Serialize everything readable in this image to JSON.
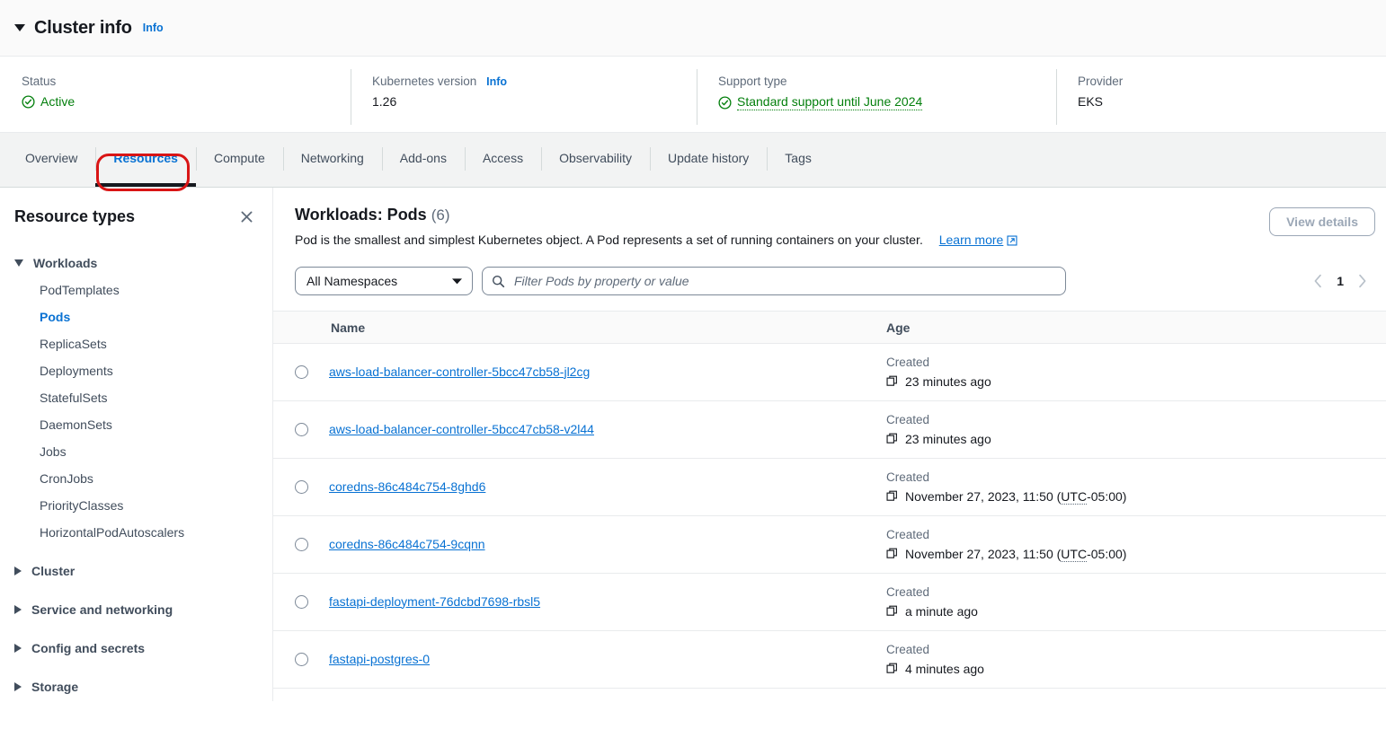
{
  "cluster_info": {
    "title": "Cluster info",
    "info_link": "Info",
    "collapse_icon": "caret-down-icon",
    "fields": [
      {
        "label": "Status",
        "value": "Active",
        "icon": "green-check-circle-icon",
        "style": "green"
      },
      {
        "label": "Kubernetes version",
        "info_link": "Info",
        "value": "1.26",
        "style": "plain"
      },
      {
        "label": "Support type",
        "value": "Standard support until June 2024",
        "icon": "green-check-circle-icon",
        "style": "green-dotted"
      },
      {
        "label": "Provider",
        "value": "EKS",
        "style": "plain"
      }
    ]
  },
  "tabs": [
    {
      "label": "Overview",
      "active": false
    },
    {
      "label": "Resources",
      "active": true
    },
    {
      "label": "Compute",
      "active": false
    },
    {
      "label": "Networking",
      "active": false
    },
    {
      "label": "Add-ons",
      "active": false
    },
    {
      "label": "Access",
      "active": false
    },
    {
      "label": "Observability",
      "active": false
    },
    {
      "label": "Update history",
      "active": false
    },
    {
      "label": "Tags",
      "active": false
    }
  ],
  "annotation": {
    "shape": "rounded-rectangle",
    "color": "#d91515",
    "target": "Resources"
  },
  "sidebar": {
    "title": "Resource types",
    "close_icon": "close-icon",
    "groups": [
      {
        "label": "Workloads",
        "expanded": true,
        "items": [
          {
            "label": "PodTemplates",
            "selected": false
          },
          {
            "label": "Pods",
            "selected": true
          },
          {
            "label": "ReplicaSets",
            "selected": false
          },
          {
            "label": "Deployments",
            "selected": false
          },
          {
            "label": "StatefulSets",
            "selected": false
          },
          {
            "label": "DaemonSets",
            "selected": false
          },
          {
            "label": "Jobs",
            "selected": false
          },
          {
            "label": "CronJobs",
            "selected": false
          },
          {
            "label": "PriorityClasses",
            "selected": false
          },
          {
            "label": "HorizontalPodAutoscalers",
            "selected": false
          }
        ]
      },
      {
        "label": "Cluster",
        "expanded": false,
        "items": []
      },
      {
        "label": "Service and networking",
        "expanded": false,
        "items": []
      },
      {
        "label": "Config and secrets",
        "expanded": false,
        "items": []
      },
      {
        "label": "Storage",
        "expanded": false,
        "items": []
      }
    ]
  },
  "main": {
    "heading": "Workloads: Pods",
    "count": "(6)",
    "description": "Pod is the smallest and simplest Kubernetes object. A Pod represents a set of running containers on your cluster.",
    "learn_more": "Learn more",
    "learn_more_icon": "external-link-icon",
    "view_details_label": "View details",
    "view_details_disabled": true,
    "namespace_filter": {
      "value": "All Namespaces",
      "icon": "chevron-down-icon"
    },
    "search": {
      "placeholder": "Filter Pods by property or value",
      "value": "",
      "icon": "search-icon"
    },
    "pagination": {
      "page": "1",
      "prev_icon": "chevron-left-icon",
      "next_icon": "chevron-right-icon",
      "prev_disabled": true,
      "next_disabled": true
    },
    "table": {
      "columns": [
        "Name",
        "Age"
      ],
      "rows": [
        {
          "name": "aws-load-balancer-controller-5bcc47cb58-jl2cg",
          "age_label": "Created",
          "age_value": "23 minutes ago",
          "copy_icon": "copy-icon",
          "selected": false
        },
        {
          "name": "aws-load-balancer-controller-5bcc47cb58-v2l44",
          "age_label": "Created",
          "age_value": "23 minutes ago",
          "copy_icon": "copy-icon",
          "selected": false
        },
        {
          "name": "coredns-86c484c754-8ghd6",
          "age_label": "Created",
          "age_value_pre": "November 27, 2023, 11:50 (",
          "age_abbr": "UTC",
          "age_value_post": "-05:00)",
          "copy_icon": "copy-icon",
          "selected": false
        },
        {
          "name": "coredns-86c484c754-9cqnn",
          "age_label": "Created",
          "age_value_pre": "November 27, 2023, 11:50 (",
          "age_abbr": "UTC",
          "age_value_post": "-05:00)",
          "copy_icon": "copy-icon",
          "selected": false
        },
        {
          "name": "fastapi-deployment-76dcbd7698-rbsl5",
          "age_label": "Created",
          "age_value": "a minute ago",
          "copy_icon": "copy-icon",
          "selected": false
        },
        {
          "name": "fastapi-postgres-0",
          "age_label": "Created",
          "age_value": "4 minutes ago",
          "copy_icon": "copy-icon",
          "selected": false
        }
      ]
    }
  },
  "colors": {
    "link": "#0972d3",
    "success": "#037f0c",
    "annotation": "#d91515",
    "text": "#16191f",
    "muted": "#5f6b7a"
  }
}
